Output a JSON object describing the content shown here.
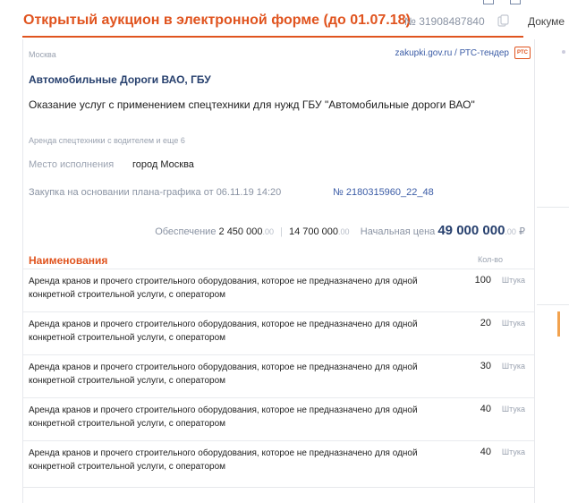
{
  "header": {
    "title": "Открытый аукцион в электронной форме (до 01.07.18)",
    "number": "№ 31908487840",
    "docs_tab": "Докуме"
  },
  "card": {
    "city": "Москва",
    "source": "zakupki.gov.ru / РТС-тендер",
    "logo_text": "РТС",
    "customer": "Автомобильные Дороги ВАО, ГБУ",
    "subject": "Оказание услуг с применением спецтехники для нужд ГБУ \"Автомобильные дороги ВАО\"",
    "category": "Аренда спецтехники с водителем и еще 6",
    "place_label": "Место исполнения",
    "place_value": "город Москва",
    "plan_text": "Закупка на основании плана-графика от 06.11.19 14:20",
    "plan_link": "№ 2180315960_22_48",
    "security_label": "Обеспечение",
    "security_value": "2 450 000",
    "security_dec": ".00",
    "security2_value": "14 700 000",
    "security2_dec": ".00",
    "price_label": "Начальная цена",
    "price_value": "49 000 000",
    "price_dec": ".00",
    "currency": "₽",
    "items_header": "Наименования",
    "qty_header": "Кол-во",
    "items": [
      {
        "name": "Аренда кранов и прочего строительного оборудования, которое не предназначено для одной конкретной строительной услуги, с оператором",
        "qty": "100",
        "unit": "Штука"
      },
      {
        "name": "Аренда кранов и прочего строительного оборудования, которое не предназначено для одной конкретной строительной услуги, с оператором",
        "qty": "20",
        "unit": "Штука"
      },
      {
        "name": "Аренда кранов и прочего строительного оборудования, которое не предназначено для одной конкретной строительной услуги, с оператором",
        "qty": "30",
        "unit": "Штука"
      },
      {
        "name": "Аренда кранов и прочего строительного оборудования, которое не предназначено для одной конкретной строительной услуги, с оператором",
        "qty": "40",
        "unit": "Штука"
      },
      {
        "name": "Аренда кранов и прочего строительного оборудования, которое не предназначено для одной конкретной строительной услуги, с оператором",
        "qty": "40",
        "unit": "Штука"
      }
    ]
  },
  "colors": {
    "accent": "#e0541f",
    "link": "#3b5ca6",
    "price": "#27406e"
  },
  "icons": {
    "copy": "copy-icon",
    "logo": "rts-logo"
  }
}
